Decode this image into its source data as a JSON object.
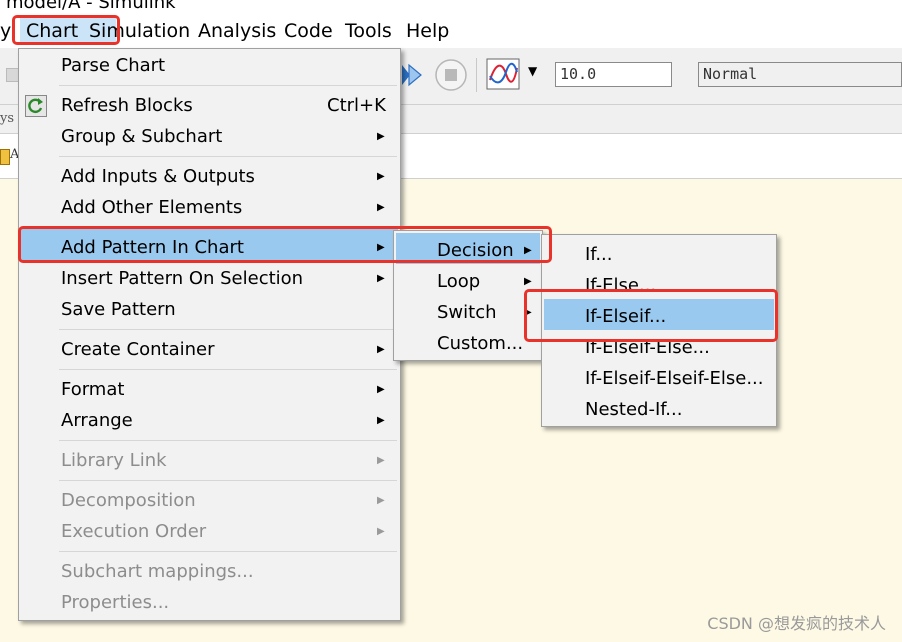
{
  "window": {
    "title": "model/A - Simulink"
  },
  "menubar": {
    "items": [
      "y",
      "Chart",
      "Simulation",
      "Analysis",
      "Code",
      "Tools",
      "Help"
    ]
  },
  "toolbar": {
    "stop_time": "10.0",
    "sim_mode": "Normal"
  },
  "addressbar": {
    "fragment": "ys"
  },
  "tab": {
    "fragment": "A"
  },
  "chart_menu": {
    "items": [
      {
        "label": "Parse Chart"
      },
      {
        "label": "Refresh Blocks",
        "shortcut": "Ctrl+K"
      },
      {
        "label": "Group & Subchart"
      },
      {
        "label": "Add Inputs & Outputs"
      },
      {
        "label": "Add Other Elements"
      },
      {
        "label": "Add Pattern In Chart"
      },
      {
        "label": "Insert Pattern On Selection"
      },
      {
        "label": "Save Pattern"
      },
      {
        "label": "Create Container"
      },
      {
        "label": "Format"
      },
      {
        "label": "Arrange"
      },
      {
        "label": "Library Link"
      },
      {
        "label": "Decomposition"
      },
      {
        "label": "Execution Order"
      },
      {
        "label": "Subchart mappings..."
      },
      {
        "label": "Properties..."
      }
    ]
  },
  "pattern_menu": {
    "items": [
      {
        "label": "Decision"
      },
      {
        "label": "Loop"
      },
      {
        "label": "Switch"
      },
      {
        "label": "Custom..."
      }
    ]
  },
  "decision_menu": {
    "items": [
      {
        "label": "If..."
      },
      {
        "label": "If-Else..."
      },
      {
        "label": "If-Elseif..."
      },
      {
        "label": "If-Elseif-Else..."
      },
      {
        "label": "If-Elseif-Elseif-Else..."
      },
      {
        "label": "Nested-If..."
      }
    ]
  },
  "watermark": "CSDN @想发疯的技术人",
  "colors": {
    "highlight": "#99c9ef",
    "annotation": "#e8322a",
    "canvas": "#fdf9e5"
  }
}
